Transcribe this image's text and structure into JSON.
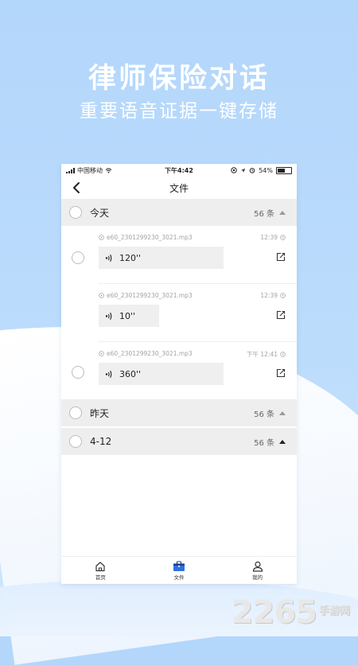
{
  "hero": {
    "title": "律师保险对话",
    "subtitle": "重要语音证据一键存储"
  },
  "status_bar": {
    "carrier": "中国移动",
    "time": "下午4:42",
    "battery": "54%"
  },
  "navbar": {
    "title": "文件"
  },
  "groups": [
    {
      "title": "今天",
      "count": "56 条",
      "records": [
        {
          "filename": "e60_2301299230_3021.mp3",
          "time": "12:39",
          "duration": "120''"
        },
        {
          "filename": "e60_2301299230_3021.mp3",
          "time": "12:39",
          "duration": "10''"
        },
        {
          "filename": "e60_2301299230_3021.mp3",
          "time": "下午 12:41",
          "duration": "360''"
        }
      ]
    },
    {
      "title": "昨天",
      "count": "56 条"
    },
    {
      "title": "4-12",
      "count": "56 条"
    }
  ],
  "tabbar": {
    "home": "首页",
    "files": "文件",
    "mine": "我的"
  },
  "colors": {
    "accent": "#2f6fe0",
    "background": "#b3d6fb"
  },
  "watermark": {
    "number": "2265",
    "text": "手游网"
  }
}
